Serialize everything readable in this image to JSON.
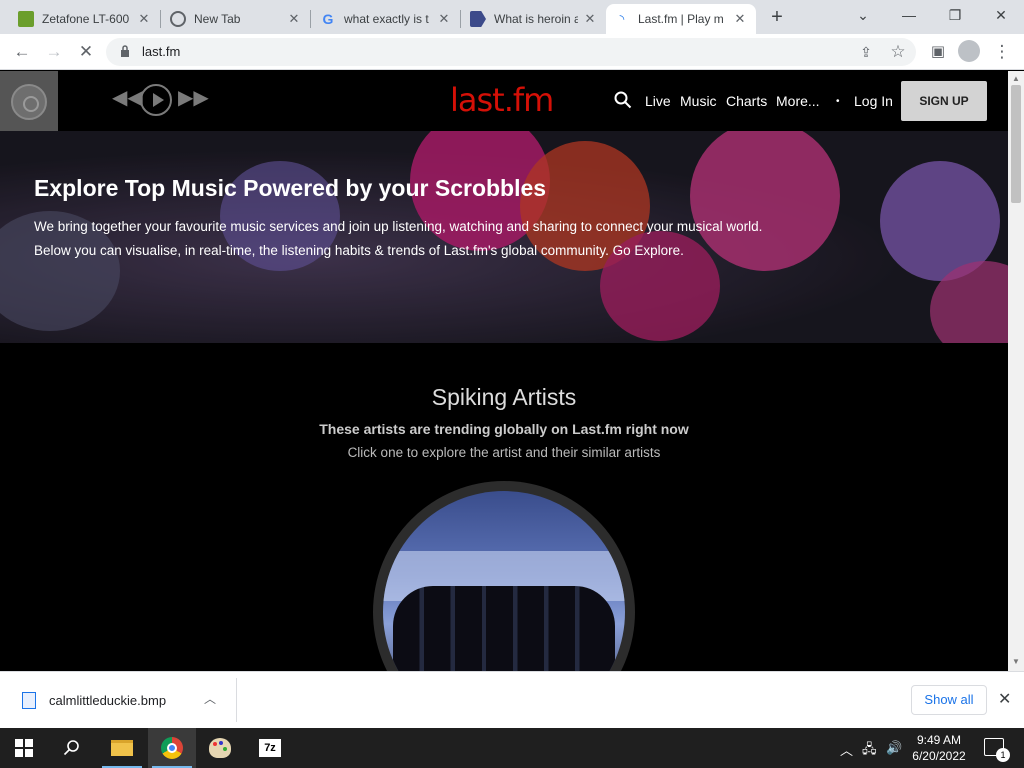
{
  "browser": {
    "tabs": [
      {
        "title": "Zetafone LT-600",
        "icon": "zetafone-favicon"
      },
      {
        "title": "New Tab",
        "icon": "chrome-icon"
      },
      {
        "title": "what exactly is t",
        "icon": "google-icon"
      },
      {
        "title": "What is heroin a",
        "icon": "page-favicon"
      },
      {
        "title": "Last.fm | Play m",
        "icon": "loading-spinner-icon"
      }
    ],
    "url": "last.fm"
  },
  "lastfm": {
    "logo": "last.fm",
    "nav": {
      "live": "Live",
      "music": "Music",
      "charts": "Charts",
      "more": "More...",
      "login": "Log In",
      "signup": "SIGN UP"
    },
    "hero": {
      "title": "Explore Top Music Powered by your Scrobbles",
      "line1": "We bring together your favourite music services and join up listening, watching and sharing to connect your musical world.",
      "line2": "Below you can visualise, in real-time, the listening habits & trends of Last.fm's global community. Go Explore."
    },
    "spiking": {
      "title": "Spiking Artists",
      "subtitle": "These artists are trending globally on Last.fm right now",
      "hint": "Click one to explore the artist and their similar artists"
    }
  },
  "downloads": {
    "file": "calmlittleduckie.bmp",
    "show_all": "Show all"
  },
  "taskbar": {
    "time": "9:49 AM",
    "date": "6/20/2022",
    "notifications": "1"
  },
  "colors": {
    "lastfm_red": "#d51007",
    "chrome_tabstrip": "#dee1e6",
    "taskbar": "#1f1f1f"
  }
}
